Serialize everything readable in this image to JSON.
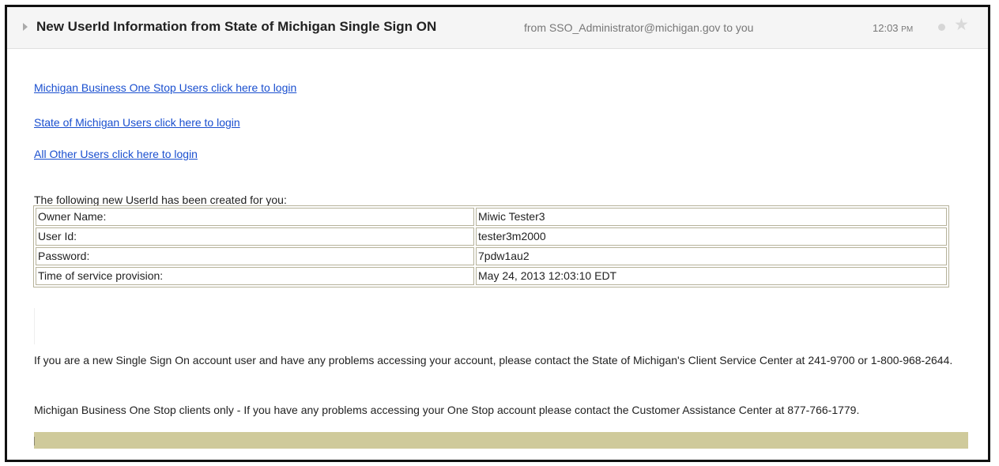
{
  "email": {
    "subject": "New UserId Information from State of Michigan Single Sign ON",
    "from_line": "from SSO_Administrator@michigan.gov to you",
    "time": "12:03",
    "time_ampm": "PM"
  },
  "links": [
    {
      "label": "Michigan Business One Stop Users click here to login"
    },
    {
      "label": "State of Michigan Users click here to login"
    },
    {
      "label": "All Other Users click here to login"
    }
  ],
  "intro": "The following new UserId has been created for you:",
  "table": {
    "rows": [
      {
        "label": "Owner Name:",
        "value": "Miwic Tester3"
      },
      {
        "label": "User Id:",
        "value": "tester3m2000"
      },
      {
        "label": "Password:",
        "value": "7pdw1au2"
      },
      {
        "label": "Time of service provision:",
        "value": "May 24, 2013 12:03:10 EDT"
      }
    ]
  },
  "paragraphs": [
    "If you are a new Single Sign On account user and have any problems accessing your account, please contact the State of Michigan's Client Service Center at 241-9700 or 1-800-968-2644.",
    "Michigan Business One Stop clients only - If you have any problems accessing your One Stop account please contact the Customer Assistance Center at 877-766-1779."
  ],
  "icons": {
    "expand": "chevron-right-icon",
    "status": "dot-icon",
    "star": "star-icon"
  },
  "colors": {
    "link": "#1a4fcf",
    "footer_bar": "#cfca9b",
    "table_border": "#b6b29a"
  }
}
